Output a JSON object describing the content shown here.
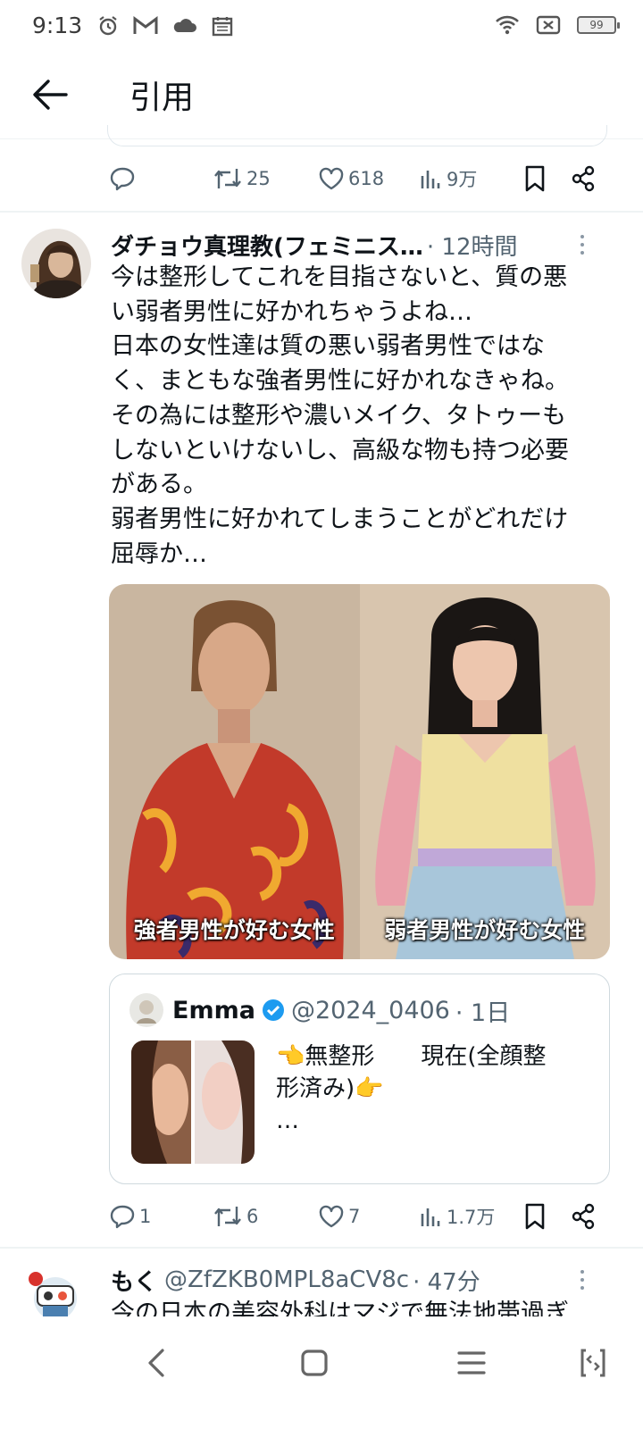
{
  "status_bar": {
    "time": "9:13",
    "battery": "99",
    "left_icons": [
      "alarm-icon",
      "gmail-icon",
      "cloud-icon",
      "calendar-icon"
    ],
    "right_icons": [
      "wifi-icon",
      "no-sim-icon",
      "battery-icon"
    ]
  },
  "header": {
    "title": "引用",
    "back_icon": "arrow-left-icon"
  },
  "previous_tweet": {
    "actions": {
      "reply_count": "",
      "retweet_count": "25",
      "like_count": "618",
      "views_count": "9万"
    }
  },
  "tweet": {
    "name": "ダチョウ真理教(フェミニス…",
    "time": "· 12時間",
    "body_lines": [
      "今は整形してこれを目指さないと、質の悪",
      "い弱者男性に好かれちゃうよね…",
      "日本の女性達は質の悪い弱者男性ではな",
      "く、まともな強者男性に好かれなきゃね。",
      "その為には整形や濃いメイク、タトゥーも",
      "しないといけないし、高級な物も持つ必要",
      "がある。",
      "弱者男性に好かれてしまうことがどれだけ",
      "屈辱か…"
    ],
    "media": {
      "left_caption": "強者男性が好む女性",
      "right_caption": "弱者男性が好む女性"
    },
    "quote": {
      "name": "Emma",
      "handle": "@2024_0406",
      "time": "· 1日",
      "text_line1": "👈無整形　　現在(全顔整",
      "text_line2": "形済み)👉",
      "text_line3": "…"
    },
    "actions": {
      "reply_count": "1",
      "retweet_count": "6",
      "like_count": "7",
      "views_count": "1.7万"
    }
  },
  "next_tweet": {
    "name": "もく",
    "handle": "@ZfZKB0MPL8aCV8c",
    "time": "· 47分",
    "peek_text": "今の日本の美容外科はマジで無法地帯過ぎ"
  },
  "colors": {
    "text_primary": "#0f1419",
    "text_secondary": "#536471",
    "verified_blue": "#1d9bf0",
    "divider": "#eff3f4"
  }
}
